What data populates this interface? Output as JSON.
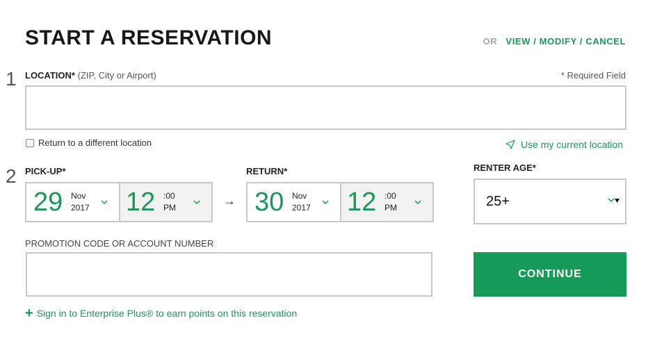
{
  "header": {
    "title": "START A RESERVATION",
    "or_label": "OR",
    "manage_link": "VIEW / MODIFY / CANCEL"
  },
  "steps": {
    "one": "1",
    "two": "2"
  },
  "location": {
    "label": "LOCATION*",
    "hint": "(ZIP, City or Airport)",
    "required_note": "* Required Field",
    "value": "",
    "return_different_label": "Return to a different location",
    "use_current_location": "Use my current location"
  },
  "pickup": {
    "label": "PICK-UP*",
    "day": "29",
    "month": "Nov",
    "year": "2017",
    "hour": "12",
    "minutes": ":00",
    "ampm": "PM"
  },
  "return": {
    "label": "RETURN*",
    "day": "30",
    "month": "Nov",
    "year": "2017",
    "hour": "12",
    "minutes": ":00",
    "ampm": "PM"
  },
  "arrow": "→",
  "renter_age": {
    "label": "RENTER AGE*",
    "value": "25+"
  },
  "promo": {
    "label": "PROMOTION CODE OR ACCOUNT NUMBER",
    "value": ""
  },
  "continue_label": "CONTINUE",
  "signin_text": "Sign in to Enterprise Plus® to earn points on this reservation",
  "colors": {
    "accent": "#169a5a",
    "border": "#c8c8c8"
  },
  "icons": {
    "geo": "location-arrow-icon",
    "chevron": "chevron-down-icon",
    "plus": "plus-icon"
  }
}
